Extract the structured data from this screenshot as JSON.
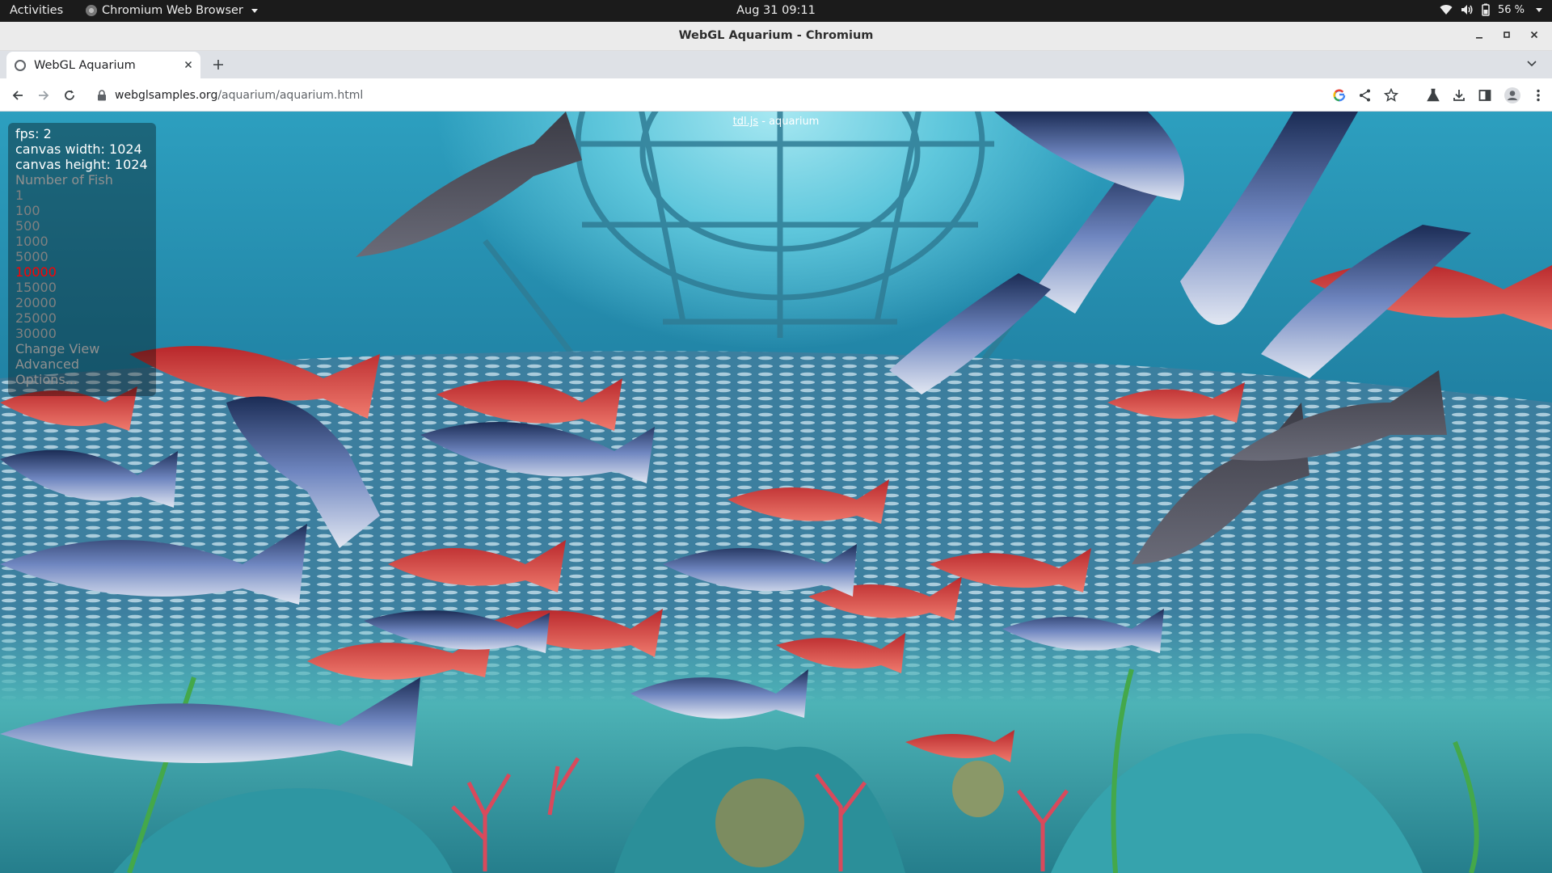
{
  "system_bar": {
    "activities": "Activities",
    "app_name": "Chromium Web Browser",
    "clock": "Aug 31  09:11",
    "battery": "56 %"
  },
  "window": {
    "title": "WebGL Aquarium - Chromium"
  },
  "tabs": [
    {
      "label": "WebGL Aquarium"
    }
  ],
  "address_bar": {
    "host": "webglsamples.org",
    "path": "/aquarium/aquarium.html"
  },
  "page": {
    "credit_link": "tdl.js",
    "credit_text": " - aquarium",
    "stats": {
      "fps": "fps: 2",
      "canvas_width": "canvas width: 1024",
      "canvas_height": "canvas height: 1024"
    },
    "fish_menu_title": "Number of Fish",
    "fish_options": [
      "1",
      "100",
      "500",
      "1000",
      "5000",
      "10000",
      "15000",
      "20000",
      "25000",
      "30000"
    ],
    "selected_fish": "10000",
    "menu_items": [
      "Change View",
      "Advanced",
      "Options..."
    ]
  },
  "colors": {
    "selected_option": "#ff0000",
    "water": "#2d9fbf"
  }
}
